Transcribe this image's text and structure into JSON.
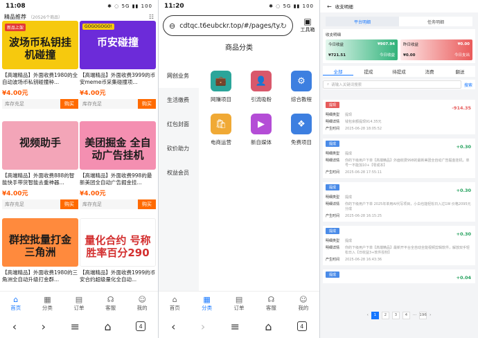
{
  "panel1": {
    "status": {
      "time": "11:08",
      "right": "✱ ◌ 5G ▮▮ 100"
    },
    "header": {
      "title": "精品推荐",
      "subtitle": "（20526个商品）"
    },
    "products": [
      {
        "tag": "新品上架",
        "art": "波场币私钥挂机碰撞",
        "title": "【高端精品】外面收费1980的全自动波场币私钥碰撞种...",
        "price": "¥4.00元",
        "stock": "库存充足",
        "buy": "购买",
        "bg": "#f6c90e"
      },
      {
        "tag": "GOGOGOGO!",
        "art": "币安碰撞",
        "title": "【高端精品】外面收费3999的币安meme币采集碰撞项...",
        "price": "¥4.00元",
        "stock": "库存充足",
        "buy": "购买",
        "bg": "#6c2bd9"
      },
      {
        "tag": "",
        "art": "视频助手",
        "title": "【高端精品】外面收费888的智能快手带货智能去重神器...",
        "price": "¥4.00元",
        "stock": "库存充足",
        "buy": "购买",
        "bg": "#f3a5b8"
      },
      {
        "tag": "",
        "art": "美团掘金 全自动广告挂机",
        "title": "【高端精品】外面收费998的最新美团全自动广告掘金挂...",
        "price": "¥4.00元",
        "stock": "库存充足",
        "buy": "购买",
        "bg": "#f48fb1"
      },
      {
        "tag": "",
        "art": "群控批量打金 三角洲",
        "title": "【高端精品】外面收费1980的三角洲全自动升级打金群...",
        "price": "",
        "stock": "",
        "buy": "",
        "bg": "#ff8a3d"
      },
      {
        "tag": "",
        "art": "量化合约 号称胜率百分290",
        "title": "【高端精品】外面收费1999的币安合约超级量化全自动...",
        "price": "",
        "stock": "",
        "buy": "",
        "bg": "#ffffff"
      }
    ]
  },
  "tabs": {
    "home": "首页",
    "category": "分类",
    "orders": "订单",
    "service": "客服",
    "mine": "我的"
  },
  "browser": {
    "tab_count": "4"
  },
  "panel2": {
    "status": {
      "time": "11:20",
      "right": "✱ ◌ 5G ▮▮ 100"
    },
    "url": "cdtqc.t6eubckr.top/#/pages/ty...",
    "toolbox": "工具箱",
    "page_title": "商品分类",
    "side": [
      "网创业务",
      "生活缴费",
      "红包封面",
      "砍价助力",
      "权益会员"
    ],
    "cats": [
      {
        "label": "网赚项目",
        "color": "#2ba59a",
        "icon": "💼"
      },
      {
        "label": "引流吸粉",
        "color": "#d9586b",
        "icon": "👤"
      },
      {
        "label": "综合教程",
        "color": "#3d7fe0",
        "icon": "⚙"
      },
      {
        "label": "电商运营",
        "color": "#f0a935",
        "icon": "🛍"
      },
      {
        "label": "新自媒体",
        "color": "#b44dd6",
        "icon": "▶"
      },
      {
        "label": "免费项目",
        "color": "#3d7fe0",
        "icon": "❖"
      }
    ]
  },
  "panel3": {
    "title": "收支明细",
    "seg": [
      "平台明细",
      "任务明细"
    ],
    "summary_label": "收支明细",
    "boxes": [
      {
        "a": "今日收益",
        "b": "¥721.51",
        "c": "¥907.94",
        "d": "今日收益"
      },
      {
        "a": "昨日收益",
        "b": "¥0.00",
        "c": "¥0.00",
        "d": "今日支出"
      }
    ],
    "filters": [
      "全部",
      "提成",
      "待提成",
      "消费",
      "翻送"
    ],
    "search_placeholder": "请输入关键词搜索",
    "search_btn": "搜索",
    "records": [
      {
        "badge": "提现",
        "amount": "-914.35",
        "type_k": "明细类型",
        "type_v": "提现",
        "detail_k": "明细详情",
        "detail_v": "钱包余额提现914.35元",
        "time_k": "产生时间",
        "time_v": "2025-06-28 18:05:52",
        "color": "#e65b5b"
      },
      {
        "badge": "提成",
        "amount": "+0.30",
        "type_k": "明细类型",
        "type_v": "提成",
        "detail_k": "明细详情",
        "detail_v": "你的下级用户下单【高端精品】外面收费998的最新美团全自动广告掘金挂机，单号一不能加10+【零成本】",
        "time_k": "产生时间",
        "time_v": "2025-06-28 17:55:11",
        "color": "#4a8be8"
      },
      {
        "badge": "提成",
        "amount": "+0.30",
        "type_k": "明细类型",
        "type_v": "提成",
        "detail_k": "明细详情",
        "detail_v": "你的下级用户下单 2025年单用AI代写项目，小白也能轻松日入过1W 价格2095元分成",
        "time_k": "产生时间",
        "time_v": "2025-06-28 16:15:25",
        "color": "#4a8be8"
      },
      {
        "badge": "提成",
        "amount": "+0.30",
        "type_k": "明细类型",
        "type_v": "提成",
        "detail_k": "明细详情",
        "detail_v": "你的下级用户下单【高端精品】最新开平台全自动全能视频剪辑软件，解放双手轻松日入【日收益3+软件授权】",
        "time_k": "产生时间",
        "time_v": "2025-06-28 16:43:36",
        "color": "#4a8be8"
      },
      {
        "badge": "提成",
        "amount": "+0.04",
        "type_k": "",
        "type_v": "",
        "detail_k": "",
        "detail_v": "",
        "time_k": "",
        "time_v": "",
        "color": "#4a8be8"
      }
    ],
    "pager": [
      "‹",
      "1",
      "2",
      "3",
      "4",
      "···",
      "196",
      "›"
    ]
  }
}
